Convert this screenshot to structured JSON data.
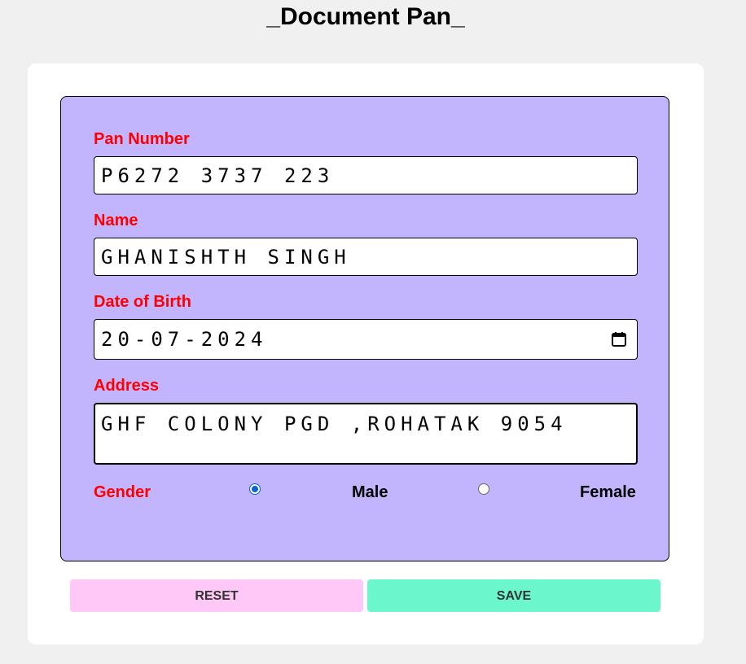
{
  "page": {
    "title": "_Document Pan_"
  },
  "form": {
    "pan": {
      "label": "Pan Number",
      "value": "P6272 3737 223"
    },
    "name": {
      "label": "Name",
      "value": "GHANISHTH SINGH"
    },
    "dob": {
      "label": "Date of Birth",
      "value": "20-07-2024"
    },
    "address": {
      "label": "Address",
      "value": "GHF COLONY PGD ,ROHATAK 9054"
    },
    "gender": {
      "label": "Gender",
      "options": [
        {
          "label": "Male",
          "checked": true
        },
        {
          "label": "Female",
          "checked": false
        }
      ]
    }
  },
  "actions": {
    "reset_label": "RESET",
    "save_label": "SAVE"
  },
  "colors": {
    "page_bg": "#f0f0f0",
    "panel_bg": "#c3b5fd",
    "label_red": "#ff0000",
    "reset_bg": "#ffc8f7",
    "save_bg": "#6bf7cb",
    "radio_blue": "#0b63d6"
  },
  "icons": {
    "date_picker": "calendar-icon"
  }
}
